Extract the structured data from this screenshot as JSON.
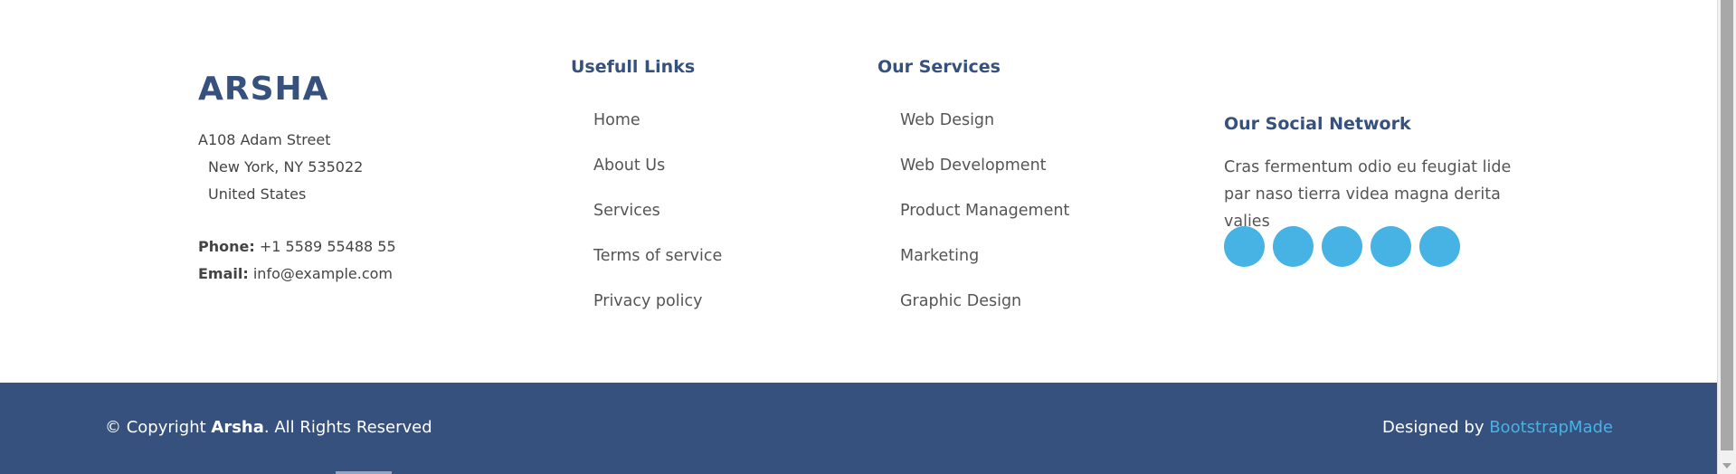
{
  "brand": {
    "name": "ARSHA"
  },
  "address": {
    "line1": "A108 Adam Street",
    "line2": "New York, NY 535022",
    "line3": "United States"
  },
  "contact": {
    "phone_label": "Phone:",
    "phone": "+1 5589 55488 55",
    "email_label": "Email:",
    "email": "info@example.com"
  },
  "useful_links": {
    "heading": "Usefull Links",
    "items": [
      "Home",
      "About Us",
      "Services",
      "Terms of service",
      "Privacy policy"
    ]
  },
  "services": {
    "heading": "Our Services",
    "items": [
      "Web Design",
      "Web Development",
      "Product Management",
      "Marketing",
      "Graphic Design"
    ]
  },
  "social": {
    "heading": "Our Social Network",
    "text": "Cras fermentum odio eu feugiat lide par naso tierra videa magna derita valies",
    "icons": [
      "twitter-icon",
      "facebook-icon",
      "instagram-icon",
      "skype-icon",
      "linkedin-icon"
    ]
  },
  "footer_bottom": {
    "copyright_prefix": "© Copyright ",
    "copyright_brand": "Arsha",
    "copyright_suffix": ". All Rights Reserved",
    "designed_by": "Designed by ",
    "designer": "BootstrapMade"
  },
  "colors": {
    "primary": "#37517e",
    "accent": "#47b2e4",
    "text": "#444444"
  }
}
